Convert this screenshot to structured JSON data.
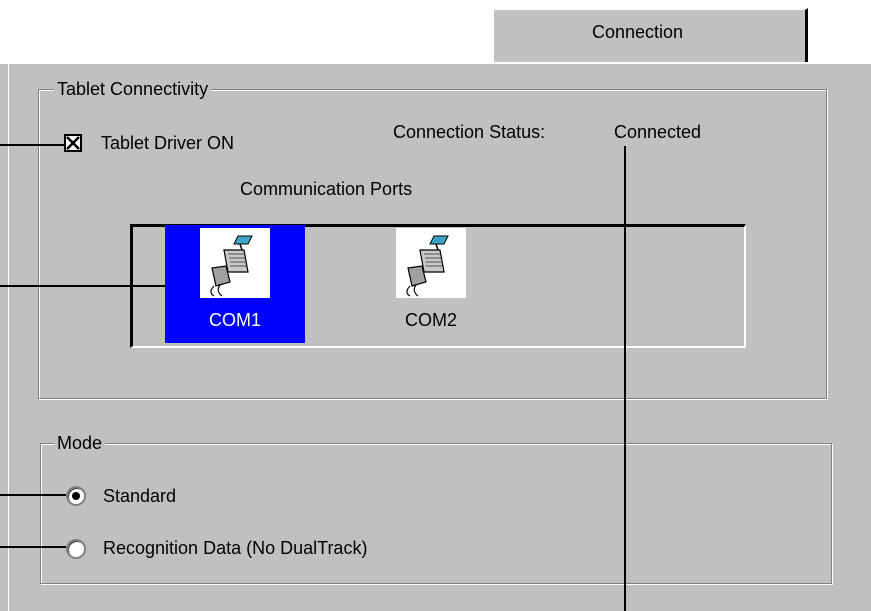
{
  "tab": {
    "label": "Connection"
  },
  "tablet_connectivity": {
    "legend": "Tablet Connectivity",
    "driver_checkbox": {
      "label": "Tablet Driver ON",
      "checked": true
    },
    "status_label": "Connection Status:",
    "status_value": "Connected",
    "ports_label": "Communication Ports",
    "ports": [
      {
        "label": "COM1",
        "selected": true,
        "icon": "serial-cable-icon"
      },
      {
        "label": "COM2",
        "selected": false,
        "icon": "serial-cable-icon"
      }
    ]
  },
  "mode": {
    "legend": "Mode",
    "options": [
      {
        "label": "Standard",
        "selected": true
      },
      {
        "label": "Recognition Data (No DualTrack)",
        "selected": false
      }
    ]
  },
  "colors": {
    "dialog": "#c0c0c0",
    "selection": "#0000ff",
    "background": "#ffffff"
  }
}
